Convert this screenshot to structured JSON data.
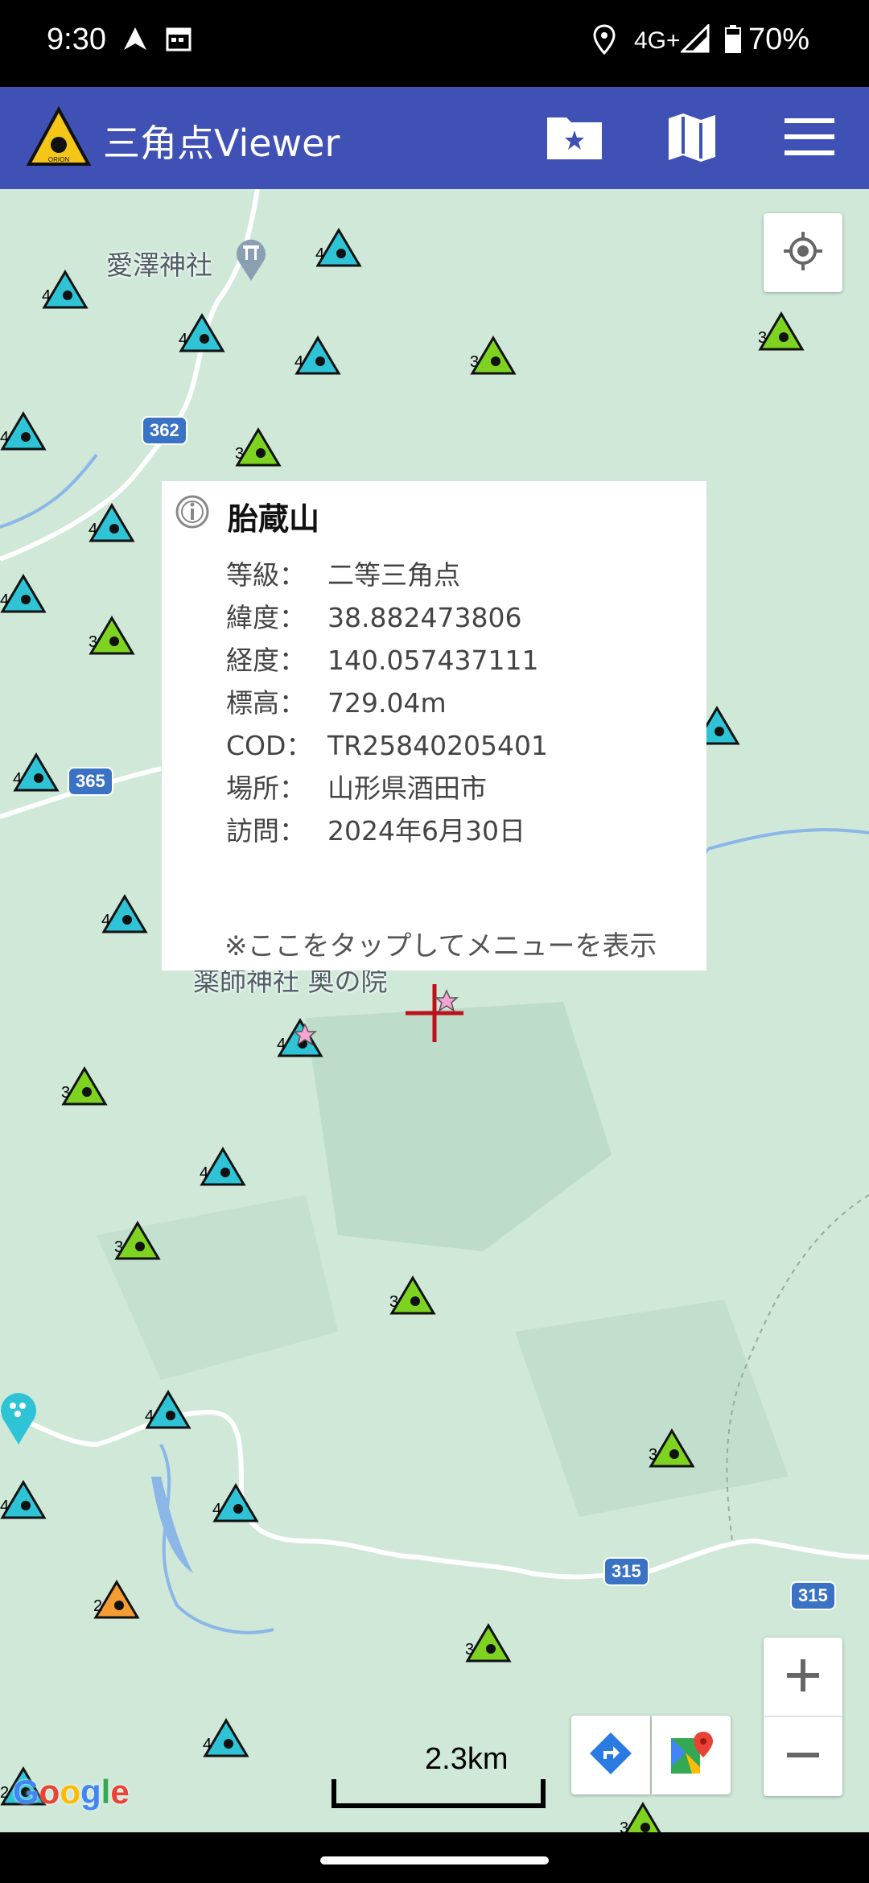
{
  "status_bar": {
    "time": "9:30",
    "network": "4G+",
    "battery": "70%"
  },
  "app_bar": {
    "title": "三角点Viewer",
    "logo_text": "ORION",
    "icons": [
      "favorite-folder-icon",
      "map-icon",
      "menu-icon"
    ]
  },
  "map": {
    "places": [
      "愛澤神社",
      "薬師神社 奥の院"
    ],
    "roads": [
      "362",
      "365",
      "315",
      "315"
    ],
    "markers": [
      {
        "n": "4",
        "cls": "c4"
      },
      {
        "n": "4",
        "cls": "c4"
      },
      {
        "n": "4",
        "cls": "c4"
      },
      {
        "n": "4",
        "cls": "c4"
      },
      {
        "n": "3",
        "cls": "c3"
      },
      {
        "n": "3",
        "cls": "c3"
      },
      {
        "n": "4",
        "cls": "c4"
      },
      {
        "n": "3",
        "cls": "c3"
      },
      {
        "n": "4",
        "cls": "c4"
      },
      {
        "n": "4",
        "cls": "c4"
      },
      {
        "n": "3",
        "cls": "c3"
      },
      {
        "n": "4",
        "cls": "c4"
      },
      {
        "n": "4",
        "cls": "c4"
      },
      {
        "n": "4",
        "cls": "c4"
      },
      {
        "n": "4",
        "cls": "c4"
      },
      {
        "n": "3",
        "cls": "c3"
      },
      {
        "n": "4",
        "cls": "c4"
      },
      {
        "n": "3",
        "cls": "c3"
      },
      {
        "n": "3",
        "cls": "c3"
      },
      {
        "n": "4",
        "cls": "c4"
      },
      {
        "n": "3",
        "cls": "c3"
      },
      {
        "n": "4",
        "cls": "c4"
      },
      {
        "n": "4",
        "cls": "c4"
      },
      {
        "n": "2",
        "cls": "c2"
      },
      {
        "n": "3",
        "cls": "c3"
      },
      {
        "n": "4",
        "cls": "c4"
      },
      {
        "n": "3",
        "cls": "c3"
      },
      {
        "n": "2",
        "cls": "c4"
      }
    ],
    "scale": "2.3km",
    "google": "Google"
  },
  "info_window": {
    "name": "胎蔵山",
    "rows": [
      {
        "label": "等級：",
        "value": "二等三角点"
      },
      {
        "label": "緯度：",
        "value": "38.882473806"
      },
      {
        "label": "経度：",
        "value": "140.057437111"
      },
      {
        "label": "標高：",
        "value": "729.04m"
      },
      {
        "label": "COD：",
        "value": "TR25840205401"
      },
      {
        "label": "場所：",
        "value": "山形県酒田市"
      },
      {
        "label": "訪問：",
        "value": "2024年6月30日"
      }
    ],
    "hint": "※ここをタップしてメニューを表示"
  },
  "colors": {
    "app_bar": "#3f51b5",
    "class4": "#2ec4d6",
    "class3": "#7ed321",
    "class2": "#f39c34",
    "map_bg": "#cfe8d8"
  }
}
